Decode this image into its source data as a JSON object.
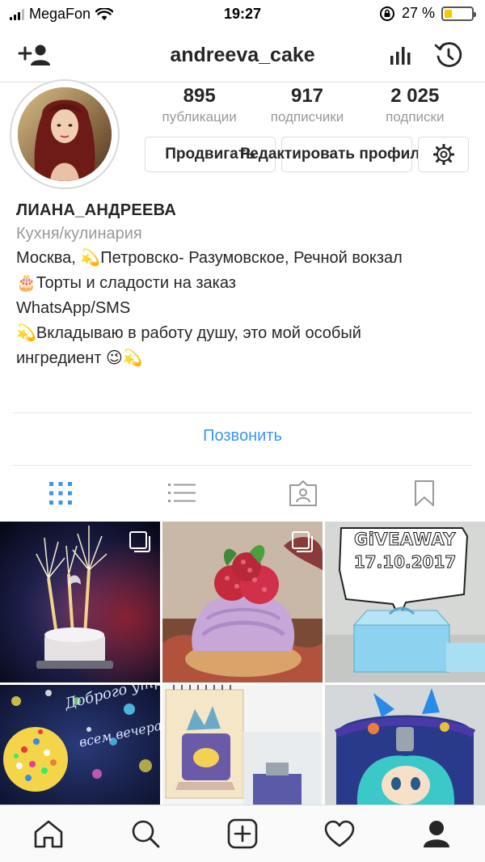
{
  "status_bar": {
    "carrier": "MegaFon",
    "time": "19:27",
    "battery_percent": "27 %",
    "battery_level": 0.27
  },
  "nav": {
    "username": "andreeva_cake",
    "add_person_icon": "add-person-icon",
    "insights_icon": "bar-chart-icon",
    "archive_icon": "history-clock-icon"
  },
  "profile": {
    "stats": [
      {
        "value": "895",
        "label": "публикации"
      },
      {
        "value": "917",
        "label": "подписчики"
      },
      {
        "value": "2 025",
        "label": "подписки"
      }
    ],
    "promote_label": "Продвигать",
    "edit_label": "Редактировать профиль",
    "settings_icon": "gear-icon"
  },
  "bio": {
    "name": "ЛИАНА_АНДРЕЕВА",
    "category": "Кухня/кулинария",
    "lines": [
      "Москва, 💫Петровско- Разумовское, Речной вокзал",
      "🎂Торты и сладости на заказ",
      "WhatsApp/SMS",
      "💫Вкладываю в работу душу, это мой особый ингредиент 😉💫"
    ]
  },
  "call_label": "Позвонить",
  "tabs": [
    {
      "icon": "grid-icon",
      "active": true
    },
    {
      "icon": "list-icon",
      "active": false
    },
    {
      "icon": "tagged-person-icon",
      "active": false
    },
    {
      "icon": "bookmark-icon",
      "active": false
    }
  ],
  "posts": {
    "giveaway_title": "GiVEAWAY",
    "giveaway_date": "17.10.2017",
    "script_caption_1": "Доброго утро",
    "script_caption_2": "всем вечера"
  },
  "tab_bar": [
    {
      "icon": "home-icon"
    },
    {
      "icon": "search-icon"
    },
    {
      "icon": "add-post-icon"
    },
    {
      "icon": "heart-icon"
    },
    {
      "icon": "profile-icon"
    }
  ],
  "colors": {
    "link_blue": "#3897f0",
    "battery_yellow": "#f5c800",
    "text_dark": "#262626",
    "text_gray": "#999999"
  }
}
